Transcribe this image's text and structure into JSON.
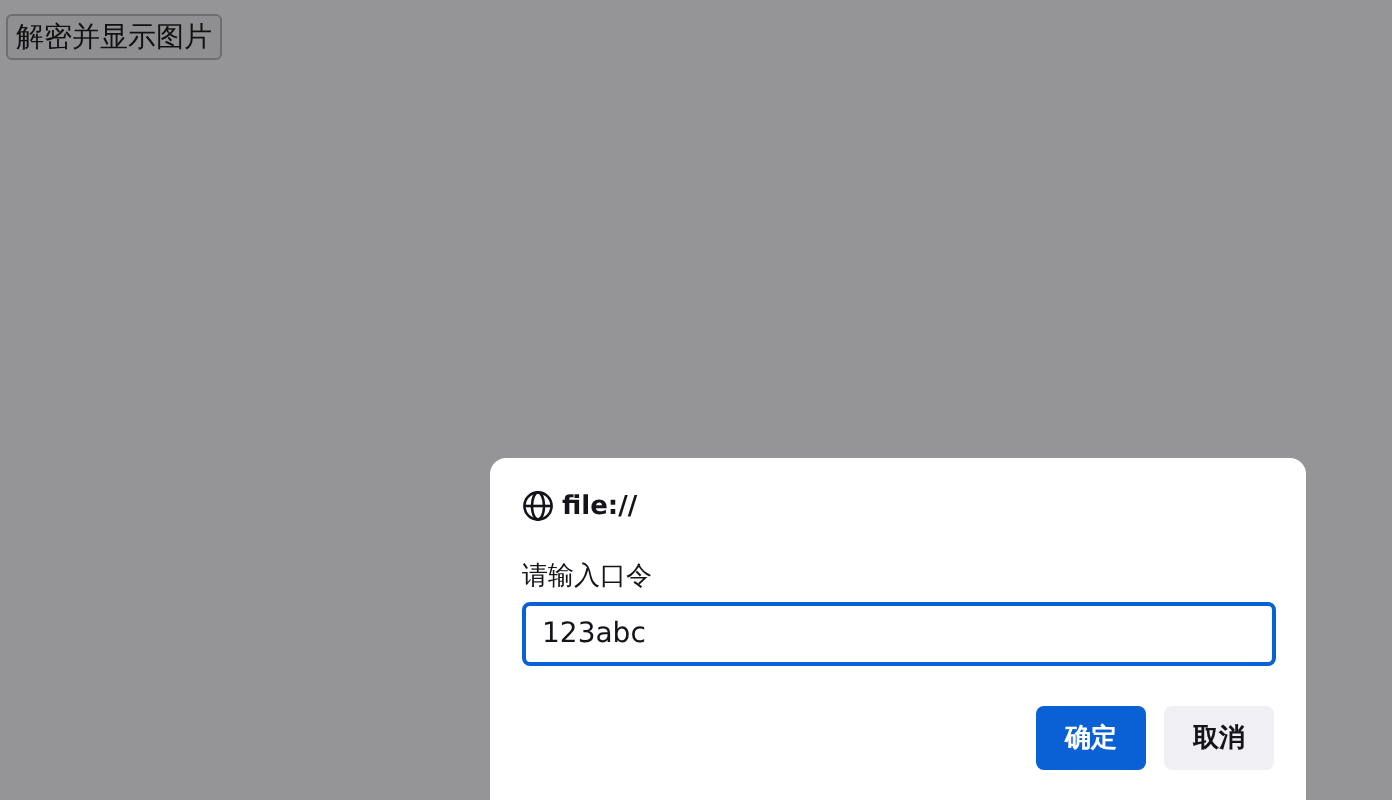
{
  "page_button": {
    "label": "解密并显示图片"
  },
  "dialog": {
    "origin": "file://",
    "prompt": "请输入口令",
    "input": {
      "value": "123abc"
    },
    "buttons": [
      {
        "label": "确定",
        "kind": "primary"
      },
      {
        "label": "取消",
        "kind": "secondary"
      }
    ]
  }
}
